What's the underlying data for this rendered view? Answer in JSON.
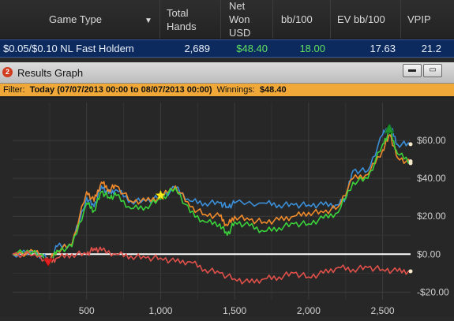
{
  "stats_table": {
    "headers": {
      "game_type": "Game Type",
      "total_hands": [
        "Total",
        "Hands"
      ],
      "net_won": [
        "Net",
        "Won",
        "USD"
      ],
      "bb100": "bb/100",
      "ev_bb100": "EV bb/100",
      "vpip": "VPIP"
    },
    "row": {
      "game_type": "$0.05/$0.10 NL Fast Holdem",
      "total_hands": "2,689",
      "net_won": "$48.40",
      "bb100": "18.00",
      "ev_bb100": "17.63",
      "vpip": "21.2"
    }
  },
  "results_window": {
    "icon_label": "2",
    "title": "Results Graph",
    "filter": {
      "label": "Filter:",
      "range": "Today (07/07/2013 00:00 to 08/07/2013 00:00)",
      "winnings_label": "Winnings:",
      "winnings_value": "$48.40"
    }
  },
  "colors": {
    "net_won": "#3a8fd8",
    "all_in_ev": "#f08a2a",
    "showdown": "#3ad23a",
    "non_showdown": "#e0504a",
    "zero_line": "#ffffff",
    "header_highlight": "#0c2a5e",
    "filter_bar": "#f0a838"
  },
  "chart_data": {
    "type": "line",
    "x_ticks": [
      "500",
      "1,000",
      "1,500",
      "2,000",
      "2,500"
    ],
    "y_ticks": [
      "$60.00",
      "$40.00",
      "$20.00",
      "$0.00",
      "-$20.00"
    ],
    "xlim": [
      0,
      2689
    ],
    "ylim": [
      -24,
      80
    ],
    "series": [
      {
        "color": "#3a8fd8",
        "points": [
          [
            0,
            0
          ],
          [
            150,
            1
          ],
          [
            250,
            -3
          ],
          [
            300,
            4
          ],
          [
            400,
            5
          ],
          [
            500,
            30
          ],
          [
            550,
            25
          ],
          [
            600,
            36
          ],
          [
            650,
            32
          ],
          [
            700,
            34
          ],
          [
            800,
            28
          ],
          [
            900,
            28
          ],
          [
            1000,
            30
          ],
          [
            1100,
            35
          ],
          [
            1200,
            28
          ],
          [
            1300,
            27
          ],
          [
            1400,
            27
          ],
          [
            1450,
            25
          ],
          [
            1500,
            27
          ],
          [
            1700,
            27
          ],
          [
            1800,
            26
          ],
          [
            1900,
            26
          ],
          [
            2000,
            26
          ],
          [
            2100,
            26
          ],
          [
            2200,
            26
          ],
          [
            2250,
            30
          ],
          [
            2300,
            44
          ],
          [
            2400,
            44
          ],
          [
            2500,
            63
          ],
          [
            2550,
            68
          ],
          [
            2600,
            58
          ],
          [
            2689,
            58
          ]
        ]
      },
      {
        "color": "#f08a2a",
        "points": [
          [
            0,
            0
          ],
          [
            150,
            1
          ],
          [
            250,
            -3
          ],
          [
            300,
            2
          ],
          [
            400,
            5
          ],
          [
            500,
            33
          ],
          [
            550,
            28
          ],
          [
            600,
            38
          ],
          [
            650,
            34
          ],
          [
            700,
            36
          ],
          [
            800,
            28
          ],
          [
            900,
            28
          ],
          [
            1000,
            30
          ],
          [
            1100,
            36
          ],
          [
            1200,
            25
          ],
          [
            1300,
            21
          ],
          [
            1400,
            20
          ],
          [
            1450,
            15
          ],
          [
            1500,
            20
          ],
          [
            1600,
            18
          ],
          [
            1700,
            17
          ],
          [
            1800,
            18
          ],
          [
            1900,
            20
          ],
          [
            2000,
            22
          ],
          [
            2100,
            22
          ],
          [
            2200,
            25
          ],
          [
            2300,
            40
          ],
          [
            2400,
            42
          ],
          [
            2500,
            55
          ],
          [
            2550,
            63
          ],
          [
            2600,
            51
          ],
          [
            2689,
            48
          ]
        ]
      },
      {
        "color": "#3ad23a",
        "points": [
          [
            0,
            0
          ],
          [
            150,
            2
          ],
          [
            250,
            -5
          ],
          [
            300,
            2
          ],
          [
            400,
            4
          ],
          [
            500,
            27
          ],
          [
            550,
            23
          ],
          [
            600,
            33
          ],
          [
            650,
            30
          ],
          [
            700,
            31
          ],
          [
            800,
            24
          ],
          [
            900,
            25
          ],
          [
            1000,
            29
          ],
          [
            1100,
            35
          ],
          [
            1200,
            22
          ],
          [
            1300,
            17
          ],
          [
            1400,
            16
          ],
          [
            1450,
            10
          ],
          [
            1500,
            17
          ],
          [
            1600,
            15
          ],
          [
            1700,
            12
          ],
          [
            1800,
            14
          ],
          [
            1900,
            16
          ],
          [
            2000,
            16
          ],
          [
            2100,
            19
          ],
          [
            2200,
            22
          ],
          [
            2300,
            38
          ],
          [
            2400,
            40
          ],
          [
            2500,
            58
          ],
          [
            2550,
            65
          ],
          [
            2600,
            53
          ],
          [
            2689,
            49
          ]
        ]
      },
      {
        "color": "#e0504a",
        "points": [
          [
            0,
            0
          ],
          [
            150,
            0
          ],
          [
            250,
            -4
          ],
          [
            300,
            -2
          ],
          [
            400,
            0
          ],
          [
            500,
            0
          ],
          [
            550,
            3
          ],
          [
            600,
            2
          ],
          [
            700,
            0
          ],
          [
            800,
            -1
          ],
          [
            900,
            -2
          ],
          [
            1000,
            -2
          ],
          [
            1100,
            -4
          ],
          [
            1200,
            -4
          ],
          [
            1300,
            -8
          ],
          [
            1400,
            -10
          ],
          [
            1500,
            -13
          ],
          [
            1600,
            -15
          ],
          [
            1700,
            -13
          ],
          [
            1800,
            -12
          ],
          [
            1900,
            -10
          ],
          [
            2000,
            -12
          ],
          [
            2100,
            -10
          ],
          [
            2200,
            -7
          ],
          [
            2300,
            -8
          ],
          [
            2400,
            -7
          ],
          [
            2500,
            -8
          ],
          [
            2600,
            -9
          ],
          [
            2689,
            -9
          ]
        ]
      }
    ]
  }
}
